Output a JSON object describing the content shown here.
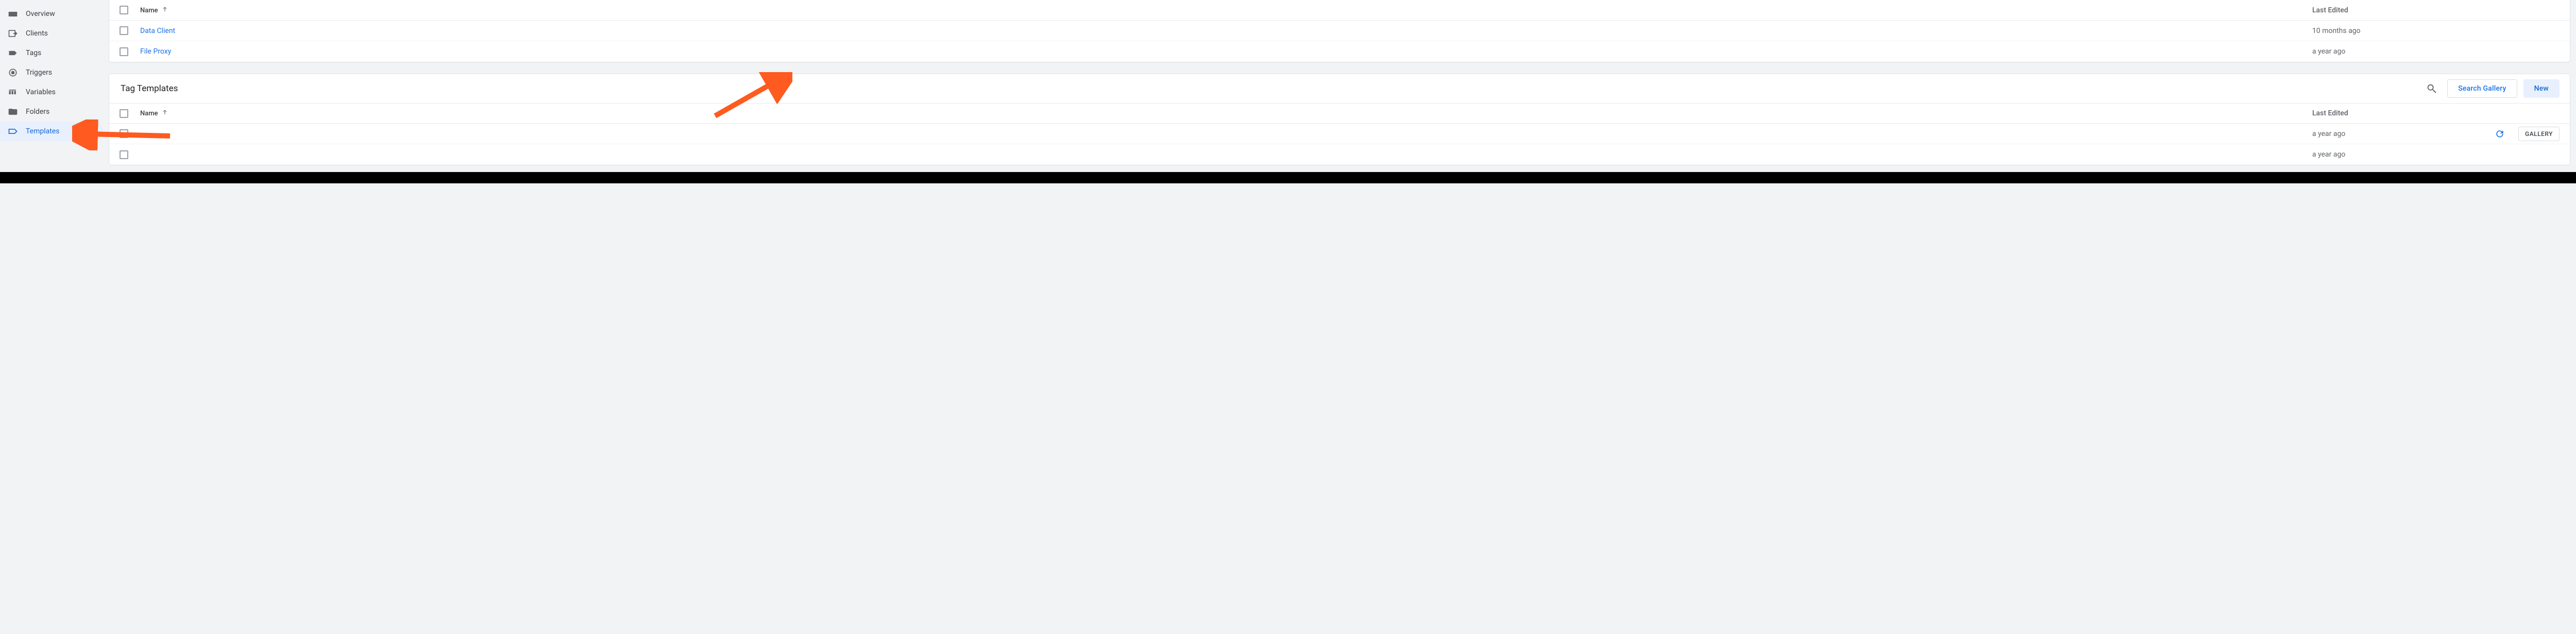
{
  "sidebar": {
    "items": [
      {
        "label": "Overview",
        "icon": "overview",
        "selected": false
      },
      {
        "label": "Clients",
        "icon": "clients",
        "selected": false
      },
      {
        "label": "Tags",
        "icon": "tags",
        "selected": false
      },
      {
        "label": "Triggers",
        "icon": "triggers",
        "selected": false
      },
      {
        "label": "Variables",
        "icon": "variables",
        "selected": false
      },
      {
        "label": "Folders",
        "icon": "folders",
        "selected": false
      },
      {
        "label": "Templates",
        "icon": "templates",
        "selected": true
      }
    ]
  },
  "top_table": {
    "header": {
      "name": "Name",
      "last_edited": "Last Edited"
    },
    "rows": [
      {
        "name": "Data Client",
        "edited": "10 months ago"
      },
      {
        "name": "File Proxy",
        "edited": "a year ago"
      }
    ]
  },
  "tag_templates": {
    "title": "Tag Templates",
    "search_gallery_label": "Search Gallery",
    "new_label": "New",
    "gallery_label": "GALLERY",
    "header": {
      "name": "Name",
      "last_edited": "Last Edited"
    },
    "rows": [
      {
        "name": "",
        "edited": "a year ago",
        "has_gallery": true
      },
      {
        "name": "",
        "edited": "a year ago",
        "has_gallery": false
      }
    ]
  }
}
